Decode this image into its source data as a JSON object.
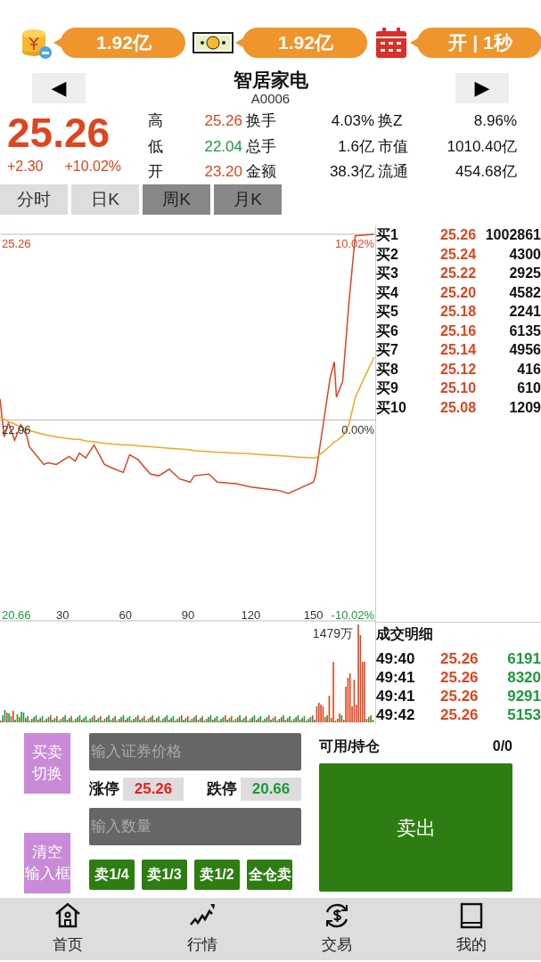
{
  "top_bar": [
    {
      "kind": "coins",
      "value": "1.92亿"
    },
    {
      "kind": "cash",
      "value": "1.92亿"
    },
    {
      "kind": "calendar",
      "value": "开 | 1秒"
    }
  ],
  "header": {
    "prev_button": "◀",
    "title": "智居家电",
    "code": "A0006",
    "next_button": "▶"
  },
  "quote": {
    "price": "25.26",
    "change": "+2.30",
    "change_pct": "+10.02%",
    "color": "#e0441e",
    "stats": [
      [
        {
          "label": "高",
          "value": "25.26",
          "color": "#e0441e"
        },
        {
          "label": "换手",
          "value": "4.03%"
        },
        {
          "label": "换Z",
          "value": "8.96%"
        }
      ],
      [
        {
          "label": "低",
          "value": "22.04",
          "color": "#1a9a3a"
        },
        {
          "label": "总手",
          "value": "1.6亿"
        },
        {
          "label": "市值",
          "value": "1010.40亿"
        }
      ],
      [
        {
          "label": "开",
          "value": "23.20",
          "color": "#e0441e"
        },
        {
          "label": "金额",
          "value": "38.3亿"
        },
        {
          "label": "流通",
          "value": "454.68亿"
        }
      ]
    ]
  },
  "period_tabs": [
    {
      "label": "分时",
      "disabled": false
    },
    {
      "label": "日K",
      "disabled": false
    },
    {
      "label": "周K",
      "disabled": true
    },
    {
      "label": "月K",
      "disabled": true
    }
  ],
  "intraday_chart": {
    "right_labels": [
      "10.02%",
      "0.00%",
      "-10.02%"
    ],
    "chart_data": {
      "type": "line",
      "xlim": [
        0,
        180
      ],
      "ylim": [
        20.66,
        25.26
      ],
      "xticks": [
        30,
        60,
        90,
        120,
        150
      ],
      "yticks": [
        {
          "value": 25.26,
          "label": "25.26"
        },
        {
          "value": 22.96,
          "label": "22.96"
        },
        {
          "value": 20.66,
          "label": "20.66"
        }
      ],
      "x": [
        0,
        2,
        4,
        7,
        10,
        13,
        14,
        21,
        23,
        27,
        33,
        36,
        38,
        41,
        45,
        50,
        55,
        59,
        62,
        66,
        72,
        76,
        81,
        86,
        91,
        93,
        100,
        104,
        113,
        120,
        126,
        133,
        138,
        143,
        150,
        151,
        155,
        158,
        160,
        161,
        164,
        167,
        170,
        179
      ],
      "series": [
        {
          "color": "#e0441e",
          "values": [
            23.22,
            22.75,
            22.92,
            22.71,
            22.9,
            22.75,
            22.63,
            22.41,
            22.43,
            22.41,
            22.51,
            22.45,
            22.55,
            22.49,
            22.65,
            22.41,
            22.35,
            22.31,
            22.53,
            22.47,
            22.29,
            22.27,
            22.35,
            22.23,
            22.19,
            22.27,
            22.29,
            22.19,
            22.17,
            22.13,
            22.11,
            22.09,
            22.05,
            22.11,
            22.19,
            22.27,
            22.96,
            23.48,
            23.68,
            23.24,
            23.44,
            24.41,
            25.24,
            25.26
          ]
        },
        {
          "color": "#f5a623",
          "values": [
            22.99,
            22.97,
            22.94,
            22.91,
            22.87,
            22.84,
            22.83,
            22.78,
            22.77,
            22.75,
            22.73,
            22.72,
            22.72,
            22.7,
            22.69,
            22.67,
            22.66,
            22.65,
            22.65,
            22.64,
            22.63,
            22.62,
            22.61,
            22.6,
            22.59,
            22.58,
            22.57,
            22.56,
            22.55,
            22.54,
            22.53,
            22.52,
            22.51,
            22.5,
            22.49,
            22.49,
            22.57,
            22.64,
            22.69,
            22.7,
            22.76,
            22.9,
            23.24,
            23.74
          ]
        }
      ]
    }
  },
  "volume_chart": {
    "max_label": "1479万"
  },
  "order_book": [
    {
      "label": "买1",
      "price": "25.26",
      "volume": "1002861"
    },
    {
      "label": "买2",
      "price": "25.24",
      "volume": "4300"
    },
    {
      "label": "买3",
      "price": "25.22",
      "volume": "2925"
    },
    {
      "label": "买4",
      "price": "25.20",
      "volume": "4582"
    },
    {
      "label": "买5",
      "price": "25.18",
      "volume": "2241"
    },
    {
      "label": "买6",
      "price": "25.16",
      "volume": "6135"
    },
    {
      "label": "买7",
      "price": "25.14",
      "volume": "4956"
    },
    {
      "label": "买8",
      "price": "25.12",
      "volume": "416"
    },
    {
      "label": "买9",
      "price": "25.10",
      "volume": "610"
    },
    {
      "label": "买10",
      "price": "25.08",
      "volume": "1209"
    }
  ],
  "trade_detail": {
    "title": "成交明细",
    "rows": [
      {
        "time": "49:40",
        "price": "25.26",
        "volume": "6191"
      },
      {
        "time": "49:41",
        "price": "25.26",
        "volume": "8320"
      },
      {
        "time": "49:41",
        "price": "25.26",
        "volume": "9291"
      },
      {
        "time": "49:42",
        "price": "25.26",
        "volume": "5153"
      }
    ]
  },
  "trade_panel": {
    "switch_button": [
      "买卖",
      "切换"
    ],
    "clear_button": [
      "清空",
      "输入框"
    ],
    "price_placeholder": "输入证券价格",
    "limit_up_label": "涨停",
    "limit_up": "25.26",
    "limit_down_label": "跌停",
    "limit_down": "20.66",
    "quantity_placeholder": "输入数量",
    "quick_buttons": [
      "卖1/4",
      "卖1/3",
      "卖1/2",
      "全仓卖"
    ],
    "position_label": "可用/持仓",
    "position_value": "0/0",
    "action_button": "卖出"
  },
  "bottom_nav": [
    {
      "kind": "home",
      "label": "首页"
    },
    {
      "kind": "market",
      "label": "行情"
    },
    {
      "kind": "trade",
      "label": "交易"
    },
    {
      "kind": "mine",
      "label": "我的"
    }
  ]
}
